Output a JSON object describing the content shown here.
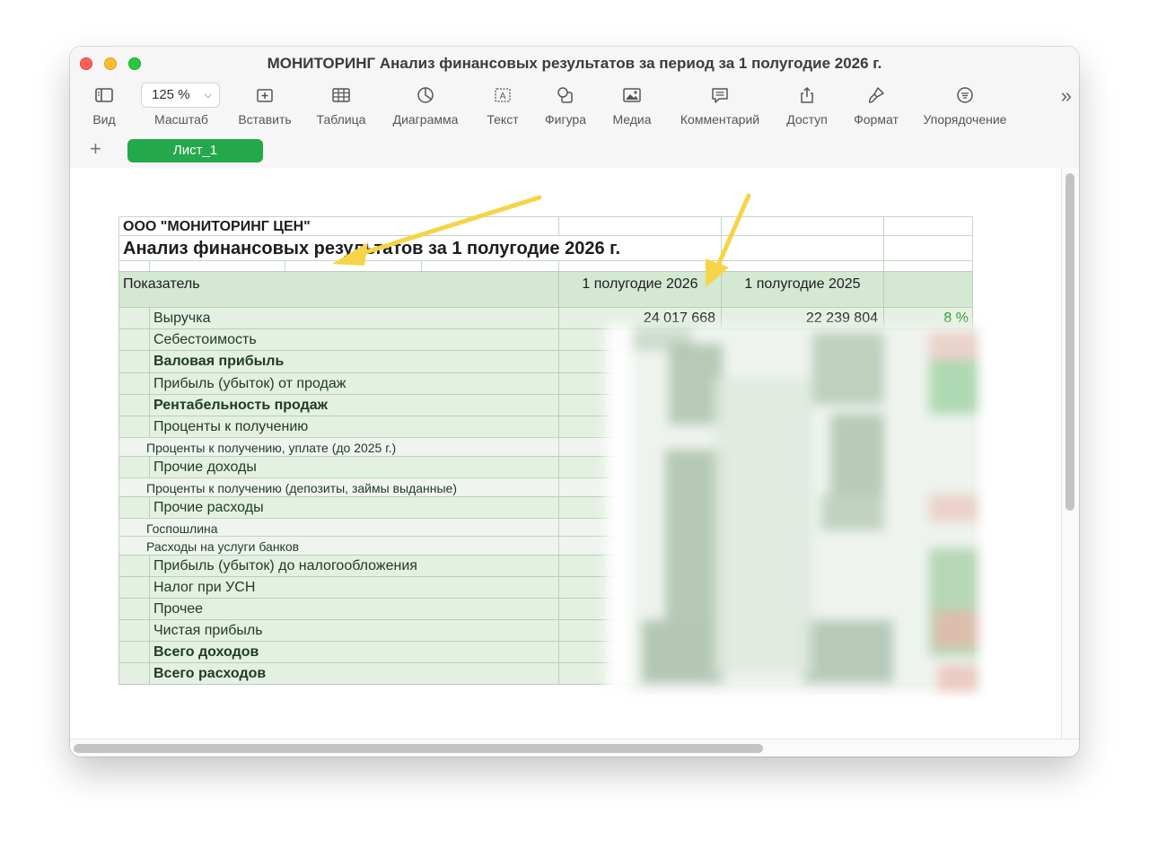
{
  "window": {
    "title": "МОНИТОРИНГ Анализ финансовых результатов за период за 1 полугодие 2026 г."
  },
  "toolbar": {
    "view_label": "Вид",
    "zoom_value": "125 %",
    "zoom_label": "Масштаб",
    "insert_label": "Вставить",
    "table_label": "Таблица",
    "chart_label": "Диаграмма",
    "text_label": "Текст",
    "shape_label": "Фигура",
    "media_label": "Медиа",
    "comment_label": "Комментарий",
    "share_label": "Доступ",
    "format_label": "Формат",
    "organize_label": "Упорядочение",
    "more_symbol": "»"
  },
  "sheets": {
    "add_symbol": "+",
    "active_tab": "Лист_1"
  },
  "table": {
    "company": "ООО \"МОНИТОРИНГ ЦЕН\"",
    "title": "Анализ финансовых результатов за 1 полугодие 2026 г.",
    "header": {
      "indicator": "Показатель",
      "period_current": "1 полугодие 2026",
      "period_previous": "1 полугодие 2025"
    },
    "rows": [
      {
        "label": "Выручка",
        "current": "24 017 668",
        "previous": "22 239 804",
        "change": "8 %"
      },
      {
        "label": "Себестоимость"
      },
      {
        "label": "Валовая прибыль"
      },
      {
        "label": "Прибыль (убыток) от продаж"
      },
      {
        "label": "Рентабельность продаж"
      },
      {
        "label": "Проценты к получению"
      },
      {
        "label": "Проценты к получению, уплате (до 2025 г.)"
      },
      {
        "label": "Прочие доходы"
      },
      {
        "label": "Проценты к получению (депозиты, займы выданные)"
      },
      {
        "label": "Прочие расходы"
      },
      {
        "label": "Госпошлина"
      },
      {
        "label": "Расходы на услуги банков"
      },
      {
        "label": "Прибыль (убыток) до налогообложения"
      },
      {
        "label": "Налог при УСН"
      },
      {
        "label": "Прочее"
      },
      {
        "label": "Чистая прибыль"
      },
      {
        "label": "Всего доходов"
      },
      {
        "label": "Всего расходов"
      }
    ]
  },
  "colors": {
    "accent_green": "#23a84b",
    "row_green": "#e4f1e2",
    "arrow_yellow": "#f5d547",
    "positive_change": "#1a9a2b"
  }
}
